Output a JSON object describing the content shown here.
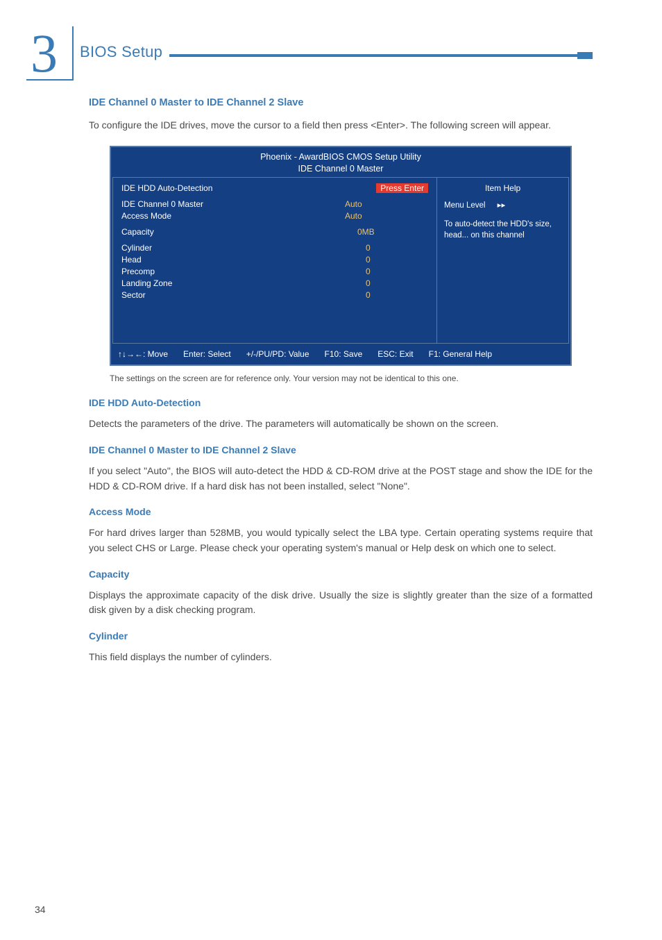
{
  "chapter_number": "3",
  "header_title": "BIOS Setup",
  "page_number": "34",
  "section_title": "IDE Channel 0 Master to IDE Channel 2 Slave",
  "intro_paragraph": "To configure the IDE drives, move the cursor to a field then press <Enter>. The following screen will appear.",
  "bios": {
    "title_line1": "Phoenix - AwardBIOS CMOS Setup Utility",
    "title_line2": "IDE Channel 0 Master",
    "rows": {
      "auto_detect_label": "IDE HDD Auto-Detection",
      "auto_detect_value": "Press Enter",
      "ch0_master_label": "IDE Channel 0 Master",
      "ch0_master_value": "Auto",
      "access_mode_label": "Access Mode",
      "access_mode_value": "Auto",
      "capacity_label": "Capacity",
      "capacity_value": "0MB",
      "cylinder_label": "Cylinder",
      "cylinder_value": "0",
      "head_label": "Head",
      "head_value": "0",
      "precomp_label": "Precomp",
      "precomp_value": "0",
      "landing_label": "Landing Zone",
      "landing_value": "0",
      "sector_label": "Sector",
      "sector_value": "0"
    },
    "help": {
      "title": "Item Help",
      "menu_level": "Menu Level",
      "body": "To auto-detect the HDD's size, head... on this channel"
    },
    "footer": {
      "move": "↑↓→←: Move",
      "select": "Enter: Select",
      "value": "+/-/PU/PD: Value",
      "save": "F10: Save",
      "exit": "ESC: Exit",
      "help": "F1: General Help"
    }
  },
  "caption": "The settings on the screen are for reference only. Your version may not be identical to this one.",
  "sections": {
    "auto_detect": {
      "title": "IDE HDD Auto-Detection",
      "body": "Detects the parameters of the drive. The parameters will automatically be shown on the screen."
    },
    "ch0_slave": {
      "title": "IDE Channel 0 Master to IDE Channel 2 Slave",
      "body": "If you select \"Auto\", the BIOS will auto-detect the HDD & CD-ROM drive at the POST stage and show the IDE for the HDD & CD-ROM drive. If a hard disk has not been installed, select \"None\"."
    },
    "access_mode": {
      "title": "Access Mode",
      "body": "For hard drives larger than 528MB, you would typically select the LBA type. Certain operating systems require that you select CHS or Large. Please check your operating system's manual or Help desk on which one to select."
    },
    "capacity": {
      "title": "Capacity",
      "body": "Displays the approximate capacity of the disk drive. Usually the size is slightly greater than the size of a formatted disk given by a disk checking program."
    },
    "cylinder": {
      "title": "Cylinder",
      "body": "This field displays the number of cylinders."
    }
  }
}
